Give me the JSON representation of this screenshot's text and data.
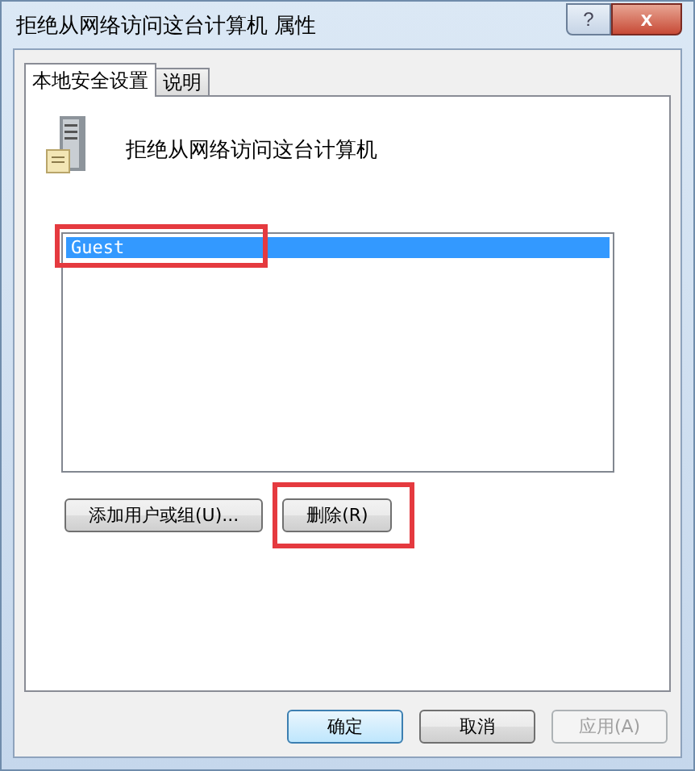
{
  "window": {
    "title": "拒绝从网络访问这台计算机 属性",
    "help_button": "?",
    "close_button": "x"
  },
  "tabs": [
    {
      "label": "本地安全设置",
      "selected": true
    },
    {
      "label": "说明",
      "selected": false
    }
  ],
  "policy": {
    "name": "拒绝从网络访问这台计算机"
  },
  "members": [
    {
      "name": "Guest",
      "selected": true,
      "highlighted": true
    }
  ],
  "actions": [
    {
      "label": "添加用户或组(U)...",
      "disabled": false,
      "highlighted": false
    },
    {
      "label": "删除(R)",
      "disabled": false,
      "highlighted": true
    }
  ],
  "buttons": [
    {
      "label": "确定",
      "default": true,
      "disabled": false
    },
    {
      "label": "取消",
      "default": false,
      "disabled": false
    },
    {
      "label": "应用(A)",
      "default": false,
      "disabled": true
    }
  ]
}
